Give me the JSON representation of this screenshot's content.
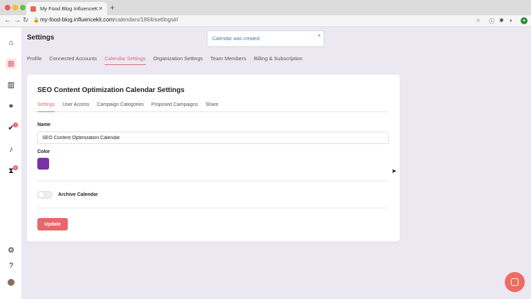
{
  "browser": {
    "tab_title": "My Food Blog InfluenceKit",
    "tab_close": "✕",
    "new_tab": "+",
    "url_host": "my-food-blog.influencekit.com",
    "url_path": "/calendars/1864/settings#/"
  },
  "page": {
    "title": "Settings"
  },
  "toast": {
    "message": "Calendar was created.",
    "close": "×"
  },
  "tabs": [
    "Profile",
    "Connected Accounts",
    "Calendar Settings",
    "Organization Settings",
    "Team Members",
    "Billing & Subscription"
  ],
  "sidebar": {
    "icons": [
      "home-icon",
      "calendar-icon",
      "chart-icon",
      "handshake-icon",
      "check-icon",
      "bell-icon",
      "hourglass-icon",
      "gear-icon",
      "help-icon"
    ],
    "badges": {
      "tasks": "3",
      "pending": "9"
    }
  },
  "card": {
    "title": "SEO Content Optimization Calendar Settings",
    "subtabs": [
      "Settings",
      "User Access",
      "Campaign Categories",
      "Proposed Campaigns",
      "Share"
    ],
    "name_label": "Name",
    "name_value": "SEO Content Optimization Calendar",
    "color_label": "Color",
    "archive_label": "Archive Calendar",
    "archive_on": false,
    "update_label": "Update"
  },
  "colors": {
    "accent": "#e06a72",
    "calendar_color": "#7b2fa8",
    "button": "#e8666c",
    "chat": "#ef6c62"
  }
}
